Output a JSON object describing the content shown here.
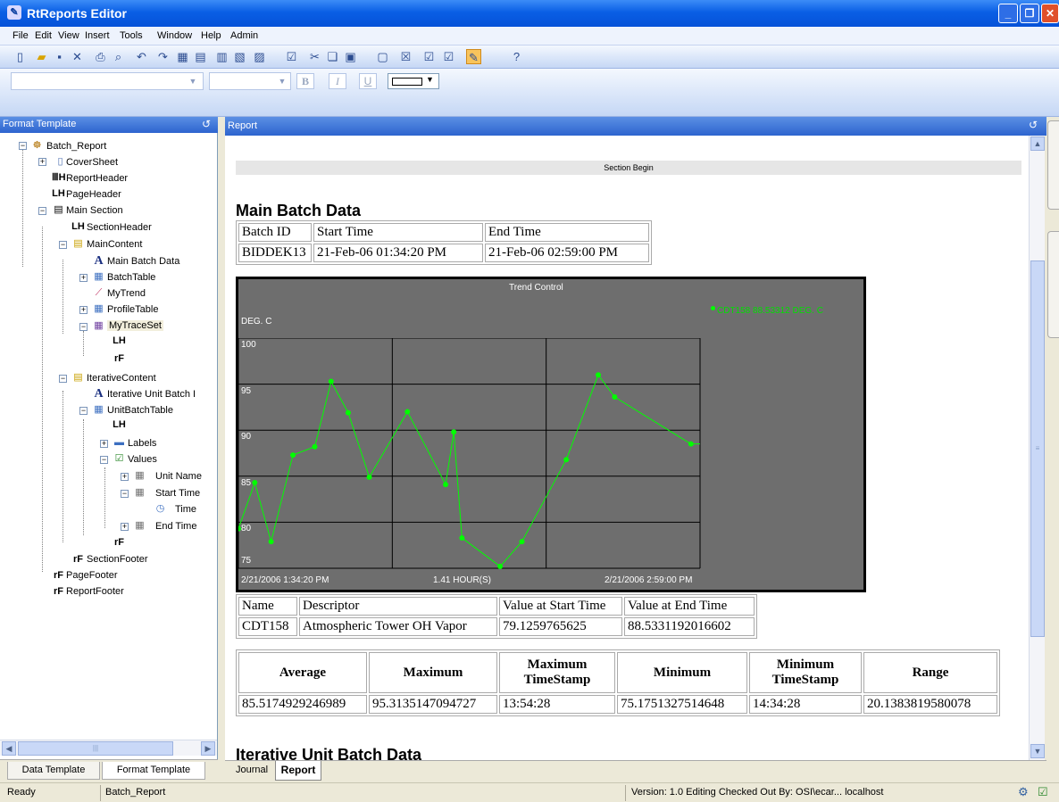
{
  "window": {
    "title": "RtReports Editor"
  },
  "menu": [
    "File",
    "Edit",
    "View",
    "Insert",
    "Tools",
    "Window",
    "Help",
    "Admin"
  ],
  "formatting_toolbar": {
    "bold": "B",
    "italic": "I",
    "underline": "U"
  },
  "left_panel": {
    "title": "Format Template",
    "tree": [
      {
        "label": "Batch_Report"
      },
      {
        "label": "CoverSheet"
      },
      {
        "label": "ReportHeader"
      },
      {
        "label": "PageHeader"
      },
      {
        "label": "Main Section"
      },
      {
        "label": "SectionHeader"
      },
      {
        "label": "MainContent"
      },
      {
        "label": "Main Batch Data"
      },
      {
        "label": "BatchTable"
      },
      {
        "label": "MyTrend"
      },
      {
        "label": "ProfileTable"
      },
      {
        "label": "MyTraceSet"
      },
      {
        "label": "IterativeContent"
      },
      {
        "label": "Iterative Unit Batch I"
      },
      {
        "label": "UnitBatchTable"
      },
      {
        "label": "Labels"
      },
      {
        "label": "Values"
      },
      {
        "label": "Unit Name"
      },
      {
        "label": "Start Time"
      },
      {
        "label": "Time"
      },
      {
        "label": "End Time"
      },
      {
        "label": "SectionFooter"
      },
      {
        "label": "PageFooter"
      },
      {
        "label": "ReportFooter"
      }
    ],
    "tabs": [
      "Data Template",
      "Format Template"
    ]
  },
  "report": {
    "title": "Report",
    "section_begin": "Section Begin",
    "heading": "Main Batch Data",
    "batch_table": {
      "headers": [
        "Batch ID",
        "Start Time",
        "End Time"
      ],
      "row": [
        "BIDDEK13",
        "21-Feb-06 01:34:20 PM",
        "21-Feb-06 02:59:00 PM"
      ]
    },
    "trend": {
      "title": "Trend Control",
      "unit_label": "DEG. C",
      "legend": "CDT158 88.53312 DEG. C",
      "start_label": "2/21/2006 1:34:20 PM",
      "span_label": "1.41 HOUR(S)",
      "end_label": "2/21/2006 2:59:00 PM"
    },
    "profile_table": {
      "headers": [
        "Name",
        "Descriptor",
        "Value at Start Time",
        "Value at End Time"
      ],
      "row": [
        "CDT158",
        "Atmospheric Tower OH Vapor",
        "79.1259765625",
        "88.5331192016602"
      ]
    },
    "stats_table": {
      "headers": [
        "Average",
        "Maximum",
        "Maximum TimeStamp",
        "Minimum",
        "Minimum TimeStamp",
        "Range"
      ],
      "row": [
        "85.5174929246989",
        "95.3135147094727",
        "13:54:28",
        "75.1751327514648",
        "14:34:28",
        "20.1383819580078"
      ]
    },
    "next_heading": "Iterative Unit Batch Data",
    "tabs": [
      "Journal",
      "Report"
    ]
  },
  "chart_data": {
    "type": "line",
    "title": "Trend Control",
    "ylabel": "DEG. C",
    "ylim": [
      75,
      100
    ],
    "yticks": [
      100,
      95,
      90,
      85,
      80,
      75
    ],
    "xlim": [
      "2/21/2006 1:34:20 PM",
      "2/21/2006 2:59:00 PM"
    ],
    "grid": true,
    "legend": "top-right",
    "series": [
      {
        "name": "CDT158 88.53312 DEG. C",
        "color": "#00ff00",
        "x": [
          "13:34:20",
          "13:37:20",
          "13:40:20",
          "13:44:20",
          "13:48:20",
          "13:51:20",
          "13:54:28",
          "13:58:20",
          "14:05:20",
          "14:12:20",
          "14:13:50",
          "14:15:20",
          "14:22:20",
          "14:26:20",
          "14:34:28",
          "14:40:20",
          "14:43:20",
          "14:57:20",
          "14:59:00"
        ],
        "values": [
          79.3,
          84.3,
          77.9,
          87.3,
          88.2,
          95.3,
          91.9,
          84.9,
          92.0,
          84.1,
          89.8,
          78.3,
          75.2,
          77.9,
          86.8,
          96.0,
          93.6,
          88.5,
          88.5
        ]
      }
    ]
  },
  "status_bar": {
    "state": "Ready",
    "document": "Batch_Report",
    "version": "Version: 1.0 Editing Checked Out By: OSI\\ecar... localhost"
  }
}
